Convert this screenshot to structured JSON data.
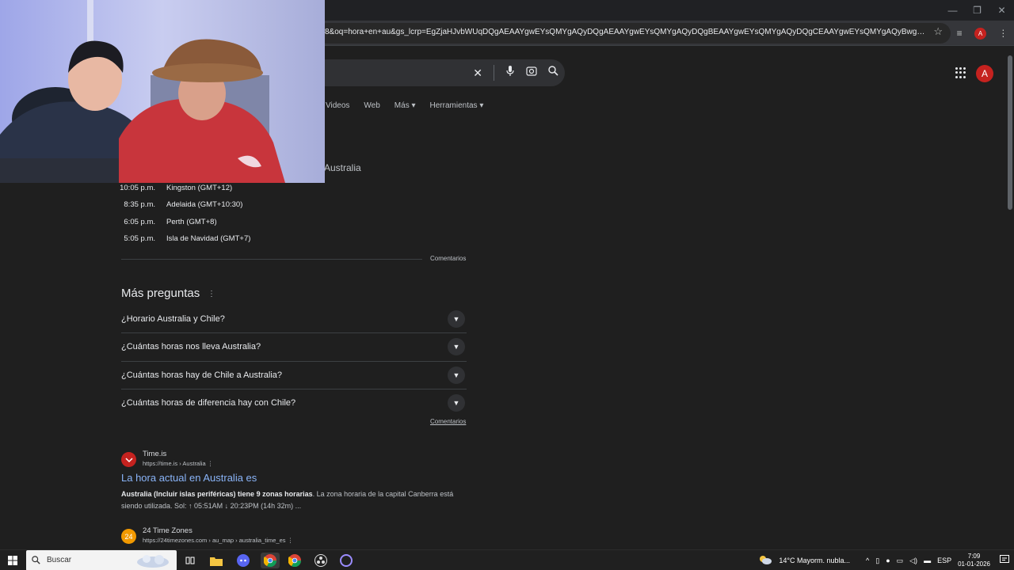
{
  "browser": {
    "url": "8&oq=hora+en+au&gs_lcrp=EgZjaHJvbWUqDQgAEAAYgwEYsQMYgAQyDQgAEAAYgwEYsQMYgAQyDQgBEAAYgwEYsQMYgAQyDQgCEAAYgwEYsQMYgAQyBwgDEAAYgAQyBggEEUY...",
    "profile_initial": "A"
  },
  "google": {
    "avatar_initial": "A",
    "tabs": [
      "Videos",
      "Web",
      "Más",
      "Herramientas"
    ]
  },
  "results": {
    "partial_heading": "Australia",
    "timezones": [
      {
        "time": "10:05 p.m.",
        "name": "Kingston (GMT+12)"
      },
      {
        "time": "8:35 p.m.",
        "name": "Adelaida (GMT+10:30)"
      },
      {
        "time": "6:05 p.m.",
        "name": "Perth (GMT+8)"
      },
      {
        "time": "5:05 p.m.",
        "name": "Isla de Navidad (GMT+7)"
      }
    ],
    "comentarios": "Comentarios",
    "paa": {
      "title": "Más preguntas",
      "questions": [
        "¿Horario Australia y Chile?",
        "¿Cuántas horas nos lleva Australia?",
        "¿Cuántas horas hay de Chile a Australia?",
        "¿Cuántas horas de diferencia hay con Chile?"
      ]
    },
    "comentarios2": "Comentarios",
    "items": [
      {
        "site": "Time.is",
        "url": "https://time.is › Australia",
        "title": "La hora actual en Australia es",
        "snippet_bold": "Australia (Incluir islas periféricas) tiene 9 zonas horarias",
        "snippet_rest": ". La zona horaria de la capital Canberra está siendo utilizada. Sol: ↑ 05:51AM ↓ 20:23PM (14h 32m) ..."
      },
      {
        "site": "24 Time Zones",
        "url": "https://24timezones.com › au_map › australia_time_es",
        "favicon_text": "24"
      }
    ]
  },
  "taskbar": {
    "search_label": "Buscar",
    "weather": "14°C  Mayorm. nubla...",
    "language": "ESP",
    "time": "7:09",
    "date": "01-01-2026"
  }
}
